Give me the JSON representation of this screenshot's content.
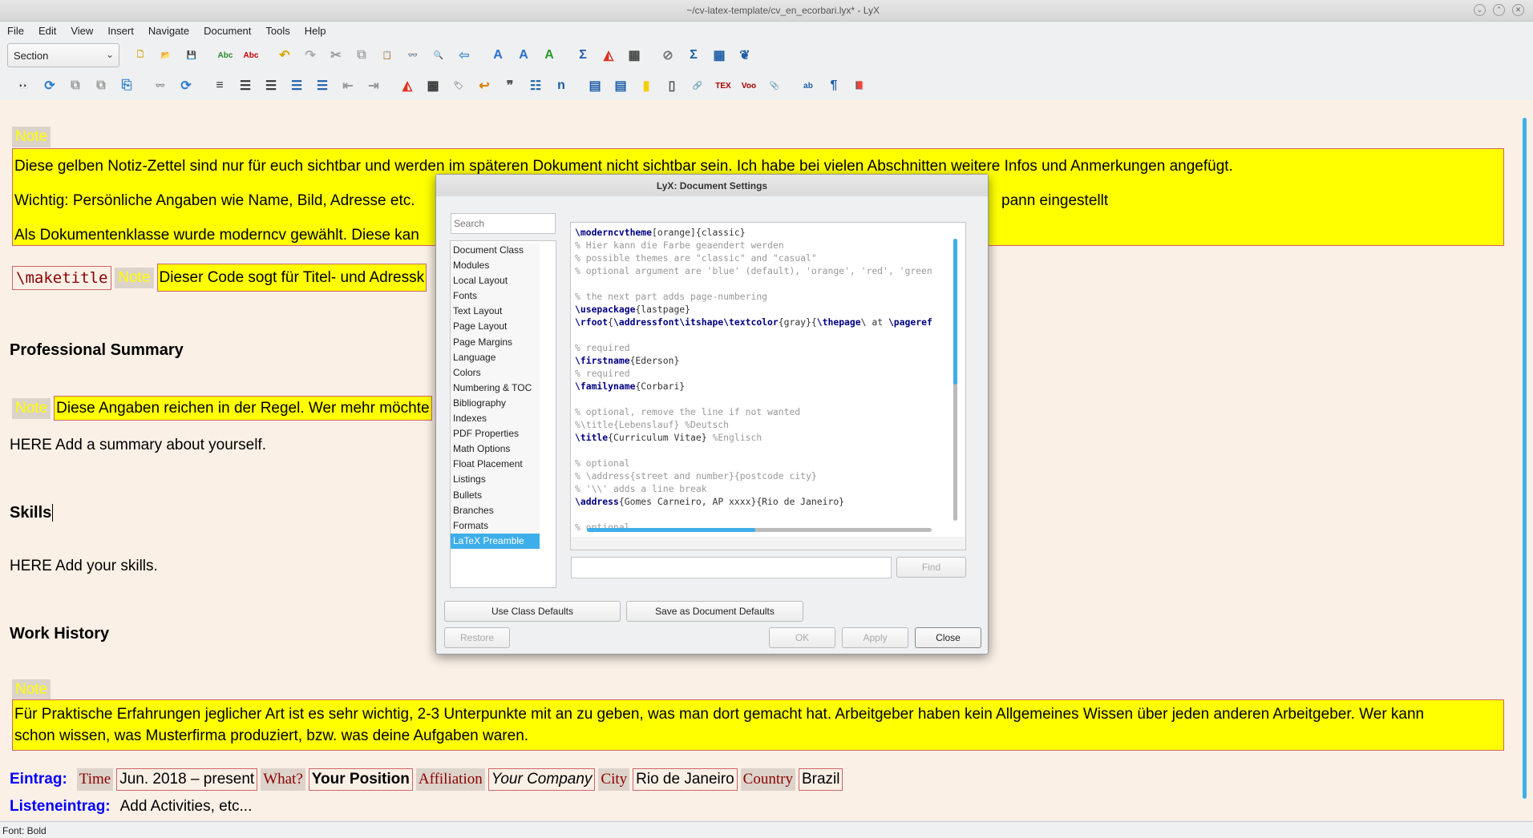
{
  "window": {
    "title": "~/cv-latex-template/cv_en_ecorbari.lyx* - LyX",
    "buttons": [
      "minimize",
      "maximize",
      "close"
    ]
  },
  "menu": [
    "File",
    "Edit",
    "View",
    "Insert",
    "Navigate",
    "Document",
    "Tools",
    "Help"
  ],
  "toolbar1": {
    "paragraph_style": "Section",
    "groups": [
      [
        {
          "n": "new-document-icon",
          "g": "🗋",
          "c": "#c9a200"
        },
        {
          "n": "open-folder-icon",
          "g": "📂",
          "c": "#4a7fb5"
        },
        {
          "n": "save-icon",
          "g": "💾",
          "c": "#4a6fa5"
        }
      ],
      [
        {
          "n": "spellcheck-icon",
          "g": "Abc",
          "c": "#2a8a2a"
        },
        {
          "n": "continuous-spellcheck-icon",
          "g": "Abc",
          "c": "#c00"
        }
      ],
      [
        {
          "n": "undo-icon",
          "g": "↶",
          "c": "#d9a400"
        },
        {
          "n": "redo-icon",
          "g": "↷",
          "c": "#aaa"
        },
        {
          "n": "cut-icon",
          "g": "✂",
          "c": "#999"
        },
        {
          "n": "copy-icon",
          "g": "⧉",
          "c": "#aaa"
        },
        {
          "n": "paste-icon",
          "g": "📋",
          "c": "#a67c52"
        },
        {
          "n": "find-binoculars-icon",
          "g": "👓",
          "c": "#333"
        },
        {
          "n": "find-replace-icon",
          "g": "🔍",
          "c": "#1d5fa8"
        },
        {
          "n": "back-arrow-icon",
          "g": "⇦",
          "c": "#5a9bd5"
        }
      ],
      [
        {
          "n": "text-style-icon",
          "g": "A",
          "c": "#2a6fcf"
        },
        {
          "n": "character-style-icon",
          "g": "A",
          "c": "#2a6fcf"
        },
        {
          "n": "change-tracking-icon",
          "g": "A",
          "c": "#2a9a2a"
        }
      ],
      [
        {
          "n": "math-sigma-icon",
          "g": "Σ",
          "c": "#1d5fa8"
        },
        {
          "n": "insert-graphics-icon",
          "g": "◭",
          "c": "#e03020"
        },
        {
          "n": "insert-table-icon",
          "g": "▦",
          "c": "#444"
        }
      ],
      [
        {
          "n": "navigator-icon",
          "g": "⊘",
          "c": "#777"
        },
        {
          "n": "math-panel-icon",
          "g": "Σ",
          "c": "#1d5fa8"
        },
        {
          "n": "matrix-panel-icon",
          "g": "▦",
          "c": "#1d5fa8"
        },
        {
          "n": "view-source-icon",
          "g": "❦",
          "c": "#1d5fa8"
        }
      ]
    ]
  },
  "toolbar2": {
    "groups": [
      [
        {
          "n": "view-pdf-icon",
          "g": "👀",
          "c": "#222"
        },
        {
          "n": "update-icon",
          "g": "⟳",
          "c": "#2a7fd5"
        },
        {
          "n": "view-master-icon",
          "g": "⧉",
          "c": "#999"
        },
        {
          "n": "update-master-icon",
          "g": "⧉",
          "c": "#999"
        },
        {
          "n": "export-icon",
          "g": "⎘",
          "c": "#2a7fd5"
        }
      ],
      [
        {
          "n": "view-other-formats-icon",
          "g": "👓",
          "c": "#666"
        },
        {
          "n": "update-other-formats-icon",
          "g": "⟳",
          "c": "#2a7fd5"
        }
      ],
      [
        {
          "n": "standard-paragraph-icon",
          "g": "≡",
          "c": "#333"
        },
        {
          "n": "enumerate-list-icon",
          "g": "☰",
          "c": "#333"
        },
        {
          "n": "itemize-list-icon",
          "g": "☰",
          "c": "#333"
        },
        {
          "n": "description-list-icon",
          "g": "☰",
          "c": "#1d5fa8"
        },
        {
          "n": "labeling-list-icon",
          "g": "☰",
          "c": "#1d5fa8"
        },
        {
          "n": "decrease-depth-icon",
          "g": "⇤",
          "c": "#999"
        },
        {
          "n": "increase-depth-icon",
          "g": "⇥",
          "c": "#999"
        }
      ],
      [
        {
          "n": "insert-figure-float-icon",
          "g": "◭",
          "c": "#e03020"
        },
        {
          "n": "insert-table-float-icon",
          "g": "▦",
          "c": "#333"
        },
        {
          "n": "insert-label-icon",
          "g": "🏷",
          "c": "#999"
        },
        {
          "n": "insert-cross-reference-icon",
          "g": "↩",
          "c": "#d98000"
        },
        {
          "n": "insert-citation-icon",
          "g": "❞",
          "c": "#555"
        },
        {
          "n": "insert-index-icon",
          "g": "☷",
          "c": "#1d5fa8"
        },
        {
          "n": "insert-nomenclature-icon",
          "g": "n",
          "c": "#1d5fa8"
        }
      ],
      [
        {
          "n": "insert-footnote-icon",
          "g": "▤",
          "c": "#1d5fa8"
        },
        {
          "n": "insert-marginal-note-icon",
          "g": "▤",
          "c": "#1d5fa8"
        },
        {
          "n": "insert-note-icon",
          "g": "▮",
          "c": "#f0d000"
        },
        {
          "n": "insert-box-icon",
          "g": "▯",
          "c": "#555"
        },
        {
          "n": "insert-hyperlink-icon",
          "g": "🔗",
          "c": "#888"
        },
        {
          "n": "insert-tex-code-icon",
          "g": "TEX",
          "c": "#b00000"
        },
        {
          "n": "insert-foo-icon",
          "g": "Voo",
          "c": "#b00000"
        },
        {
          "n": "insert-attachment-icon",
          "g": "📎",
          "c": "#999"
        }
      ],
      [
        {
          "n": "insert-special-character-icon",
          "g": "ab",
          "c": "#1d5fa8"
        },
        {
          "n": "paragraph-settings-icon",
          "g": "¶",
          "c": "#1d5fa8"
        },
        {
          "n": "document-settings-icon",
          "g": "📕",
          "c": "#a00"
        }
      ]
    ]
  },
  "document": {
    "note_label": "Note",
    "note1_lines": [
      "Diese gelben Notiz-Zettel sind nur für euch sichtbar und werden im späteren Dokument nicht sichtbar sein. Ich habe bei vielen Abschnitten weitere Infos und Anmerkungen angefügt.",
      "Wichtig: Persönliche Angaben wie Name, Bild, Adresse etc.",
      "Als Dokumentenklasse wurde moderncv gewählt. Diese kan"
    ],
    "note1_line2_tail": "pann eingestellt",
    "maketitle": "\\maketitle",
    "note2": "Dieser Code sogt für Titel- und Adressk",
    "h_summary": "Professional Summary",
    "note3": "Diese Angaben reichen in der Regel. Wer mehr möchte",
    "summary_text": "HERE Add a summary about yourself.",
    "h_skills": "Skills",
    "skills_text": "HERE Add your skills.",
    "h_work": "Work History",
    "note4_lines": [
      "Für Praktische Erfahrungen jeglicher Art ist es sehr wichtig, 2-3 Unterpunkte mit an zu geben, was man dort gemacht hat. Arbeitgeber haben kein Allgemeines Wissen über jeden anderen Arbeitgeber. Wer kann",
      "schon wissen, was Musterfirma produziert, bzw. was deine Aufgaben waren."
    ],
    "entry": {
      "label": "Eintrag:",
      "time_lbl": "Time",
      "time": "Jun. 2018 – present",
      "what_lbl": "What?",
      "what": "Your Position",
      "aff_lbl": "Affiliation",
      "aff": "Your Company",
      "city_lbl": "City",
      "city": "Rio de Janeiro",
      "country_lbl": "Country",
      "country": "Brazil"
    },
    "list_entry": {
      "label": "Listeneintrag:",
      "text": "Add Activities, etc..."
    }
  },
  "status": "Font: Bold",
  "dialog": {
    "title": "LyX: Document Settings",
    "search_placeholder": "Search",
    "categories": [
      "Document Class",
      "Modules",
      "Local Layout",
      "Fonts",
      "Text Layout",
      "Page Layout",
      "Page Margins",
      "Language",
      "Colors",
      "Numbering & TOC",
      "Bibliography",
      "Indexes",
      "PDF Properties",
      "Math Options",
      "Float Placement",
      "Listings",
      "Bullets",
      "Branches",
      "Formats",
      "LaTeX Preamble"
    ],
    "selected": "LaTeX Preamble",
    "preamble": [
      [
        [
          "k",
          "\\moderncvtheme"
        ],
        [
          "t",
          "[orange]{classic}"
        ]
      ],
      [
        [
          "c",
          "% Hier kann die Farbe geaendert werden"
        ]
      ],
      [
        [
          "c",
          "% possible themes are \"classic\" and \"casual\""
        ]
      ],
      [
        [
          "c",
          "% optional argument are 'blue' (default), 'orange', 'red', 'green"
        ]
      ],
      [],
      [
        [
          "c",
          "% the next part adds page-numbering"
        ]
      ],
      [
        [
          "k",
          "\\usepackage"
        ],
        [
          "t",
          "{lastpage}"
        ]
      ],
      [
        [
          "k",
          "\\rfoot"
        ],
        [
          "t",
          "{"
        ],
        [
          "k",
          "\\addressfont\\itshape\\textcolor"
        ],
        [
          "t",
          "{gray}{"
        ],
        [
          "k",
          "\\thepage"
        ],
        [
          "t",
          "\\ at "
        ],
        [
          "k",
          "\\pageref"
        ]
      ],
      [],
      [
        [
          "c",
          "% required"
        ]
      ],
      [
        [
          "k",
          "\\firstname"
        ],
        [
          "t",
          "{Ederson}"
        ]
      ],
      [
        [
          "c",
          "% required"
        ]
      ],
      [
        [
          "k",
          "\\familyname"
        ],
        [
          "t",
          "{Corbari}"
        ]
      ],
      [],
      [
        [
          "c",
          "% optional, remove the line if not wanted"
        ]
      ],
      [
        [
          "c",
          "%\\title{Lebenslauf} %Deutsch"
        ]
      ],
      [
        [
          "k",
          "\\title"
        ],
        [
          "t",
          "{Curriculum Vitae} "
        ],
        [
          "c",
          "%Englisch"
        ]
      ],
      [],
      [
        [
          "c",
          "% optional"
        ]
      ],
      [
        [
          "c",
          "% \\address{street and number}{postcode city}"
        ]
      ],
      [
        [
          "c",
          "% '\\\\' adds a line break"
        ]
      ],
      [
        [
          "k",
          "\\address"
        ],
        [
          "t",
          "{Gomes Carneiro, AP xxxx}{Rio de Janeiro}"
        ]
      ],
      [],
      [
        [
          "c",
          "% optional"
        ]
      ]
    ],
    "find_value": "",
    "buttons": {
      "find": "Find",
      "use_class_defaults": "Use Class Defaults",
      "save_defaults": "Save as Document Defaults",
      "restore": "Restore",
      "ok": "OK",
      "apply": "Apply",
      "close": "Close"
    }
  },
  "colors": {
    "accent": "#3daee9",
    "note_bg": "#ffff00",
    "doc_bg": "#faf0e6",
    "inset_border": "#d0646a",
    "label_red": "#8b0000",
    "entry_blue": "#0000ff"
  }
}
